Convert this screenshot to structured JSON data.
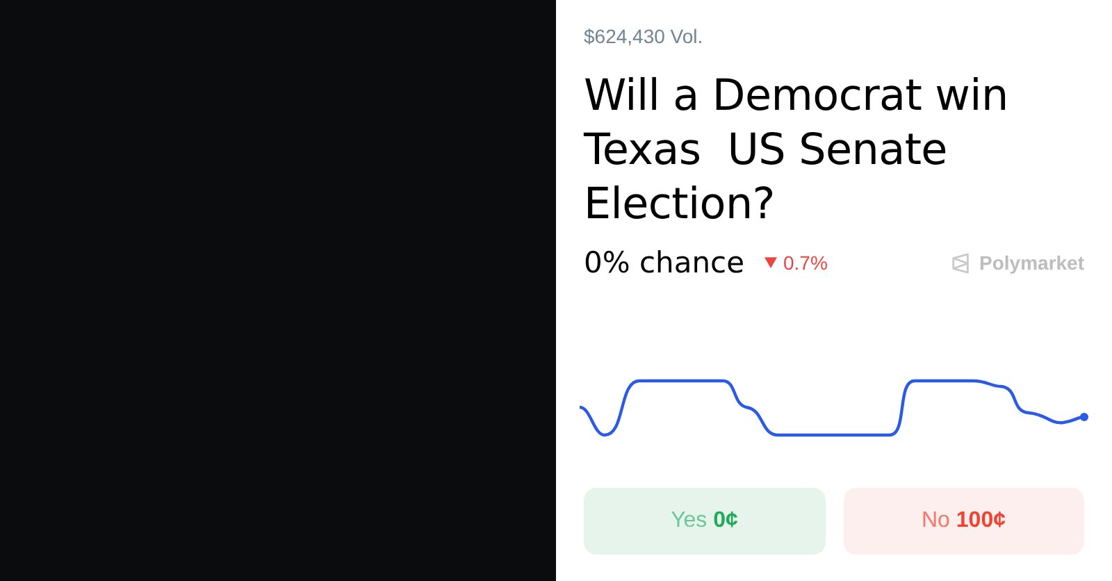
{
  "market": {
    "volume": "$624,430 Vol.",
    "title": "Will a Democrat win Texas  US Senate Election?",
    "chance": "0% chance",
    "change": {
      "falling": true,
      "value": "0.7%"
    },
    "brand": "Polymarket",
    "outcomes": [
      {
        "kind": "yes",
        "label": "Yes **0¢**"
      },
      {
        "kind": "no",
        "label": "No **100¢**"
      }
    ]
  }
}
